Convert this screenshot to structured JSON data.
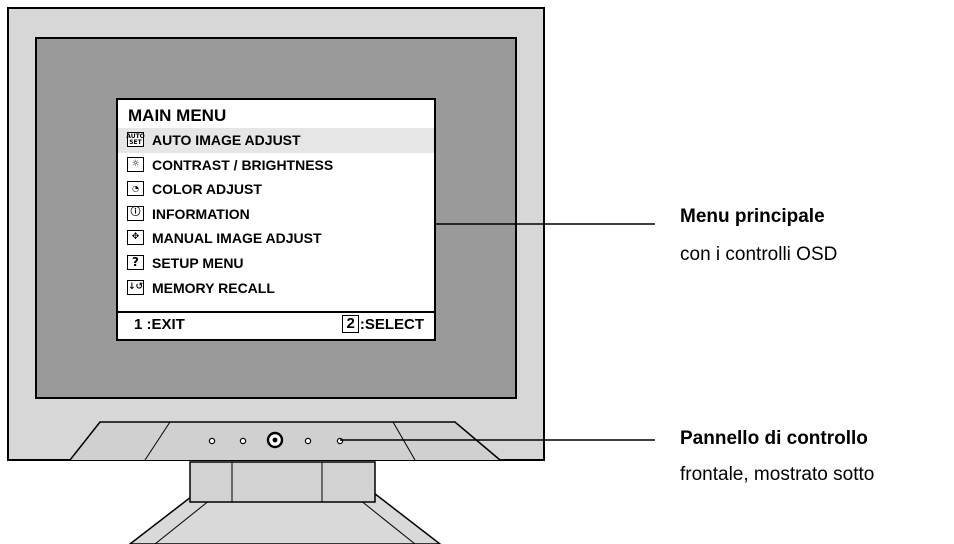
{
  "osd_menu": {
    "title": "MAIN MENU",
    "items": [
      {
        "icon": "auto-set-icon",
        "icon_text": "AUTO SET",
        "label": "AUTO IMAGE ADJUST",
        "selected": true
      },
      {
        "icon": "brightness-icon",
        "icon_text": "",
        "label": "CONTRAST / BRIGHTNESS",
        "selected": false
      },
      {
        "icon": "color-adjust-icon",
        "icon_text": "",
        "label": "COLOR ADJUST",
        "selected": false
      },
      {
        "icon": "info-icon",
        "icon_text": "",
        "label": "INFORMATION",
        "selected": false
      },
      {
        "icon": "move-arrows-icon",
        "icon_text": "",
        "label": "MANUAL IMAGE ADJUST",
        "selected": false
      },
      {
        "icon": "question-icon",
        "icon_text": "?",
        "label": "SETUP MENU",
        "selected": false
      },
      {
        "icon": "memory-recall-icon",
        "icon_text": "",
        "label": "MEMORY RECALL",
        "selected": false
      }
    ],
    "exit": "1 :EXIT",
    "select_key": "2",
    "select_text": ":SELECT"
  },
  "callouts": {
    "menu": {
      "title": "Menu principale",
      "subtitle": "con i controlli OSD"
    },
    "panel": {
      "title": "Pannello di controllo",
      "subtitle": "frontale, mostrato sotto"
    }
  },
  "colors": {
    "screen": "#9a9a9a",
    "bezel": "#d7d7d7",
    "outline": "#000000",
    "selection": "#e6e6e6"
  }
}
